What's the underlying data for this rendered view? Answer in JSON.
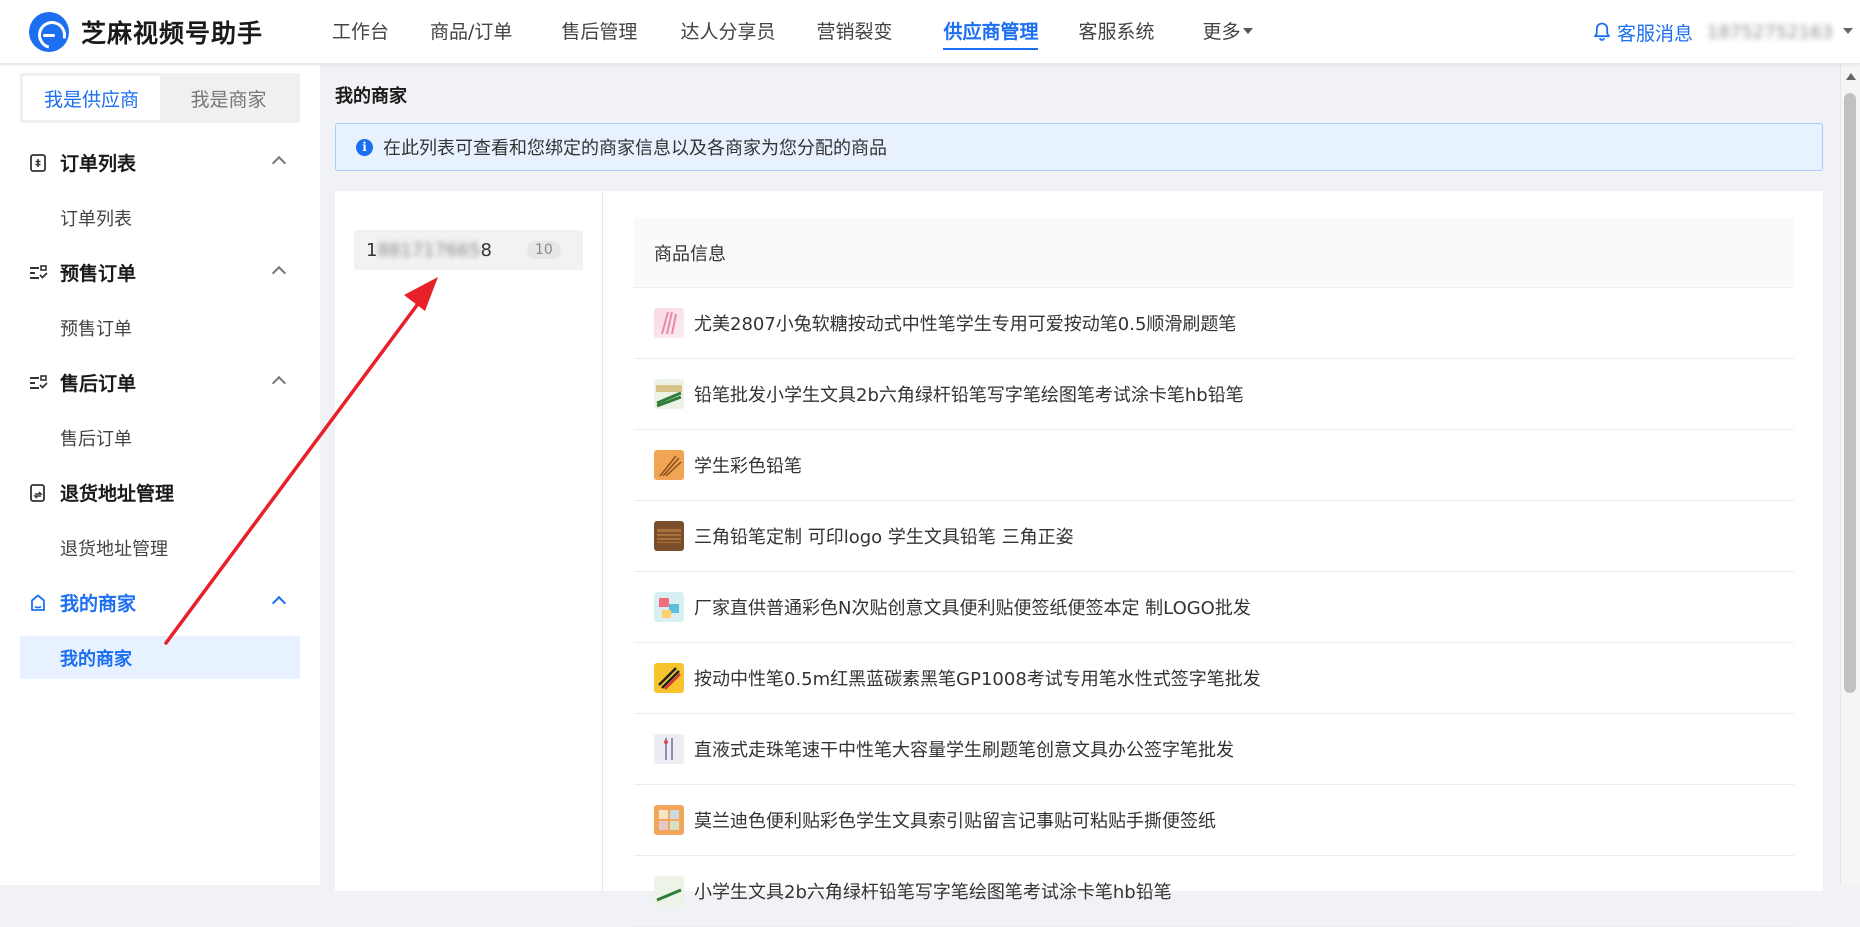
{
  "header": {
    "app_title": "芝麻视频号助手",
    "nav": [
      {
        "label": "工作台"
      },
      {
        "label": "商品/订单"
      },
      {
        "label": "售后管理"
      },
      {
        "label": "达人分享员"
      },
      {
        "label": "营销裂变"
      },
      {
        "label": "供应商管理",
        "active": true
      },
      {
        "label": "客服系统"
      },
      {
        "label": "更多"
      }
    ],
    "service_label": "客服消息",
    "account": "18752752163"
  },
  "sidebar": {
    "roles": [
      {
        "label": "我是供应商",
        "active": true
      },
      {
        "label": "我是商家"
      }
    ],
    "groups": [
      {
        "title": "订单列表",
        "icon": "order-list-icon",
        "item": "订单列表"
      },
      {
        "title": "预售订单",
        "icon": "presale-icon",
        "item": "预售订单"
      },
      {
        "title": "售后订单",
        "icon": "aftersale-icon",
        "item": "售后订单"
      },
      {
        "title": "退货地址管理",
        "icon": "return-address-icon",
        "item": "退货地址管理"
      },
      {
        "title": "我的商家",
        "icon": "merchant-icon",
        "item": "我的商家",
        "active": true
      }
    ]
  },
  "main": {
    "page_title": "我的商家",
    "tip": "在此列表可查看和您绑定的商家信息以及各商家为您分配的商品",
    "merchant": {
      "name": "18817176658",
      "count": "10"
    },
    "products_header": "商品信息",
    "products": [
      {
        "name": "尤美2807小兔软糖按动式中性笔学生专用可爱按动笔0.5顺滑刷题笔",
        "thumb": "pink-pens"
      },
      {
        "name": "铅笔批发小学生文具2b六角绿杆铅笔写字笔绘图笔考试涂卡笔hb铅笔",
        "thumb": "green-pencils"
      },
      {
        "name": "学生彩色铅笔",
        "thumb": "color-pencils"
      },
      {
        "name": "三角铅笔定制 可印logo 学生文具铅笔 三角正姿",
        "thumb": "wood-pencils"
      },
      {
        "name": "厂家直供普通彩色N次贴创意文具便利贴便签纸便签本定 制LOGO批发",
        "thumb": "sticky-notes"
      },
      {
        "name": "按动中性笔0.5m红黑蓝碳素黑笔GP1008考试专用笔水性式签字笔批发",
        "thumb": "gel-pens"
      },
      {
        "name": "直液式走珠笔速干中性笔大容量学生刷题笔创意文具办公签字笔批发",
        "thumb": "rollerball-pens"
      },
      {
        "name": "莫兰迪色便利贴彩色学生文具索引贴留言记事贴可粘贴手撕便签纸",
        "thumb": "morandi-notes"
      },
      {
        "name": "小学生文具2b六角绿杆铅笔写字笔绘图笔考试涂卡笔hb铅笔",
        "thumb": "green-pencils-2"
      }
    ]
  },
  "colors": {
    "accent": "#1d6ff2",
    "tip_bg": "#e8f2ff",
    "arrow": "#e8202a"
  }
}
